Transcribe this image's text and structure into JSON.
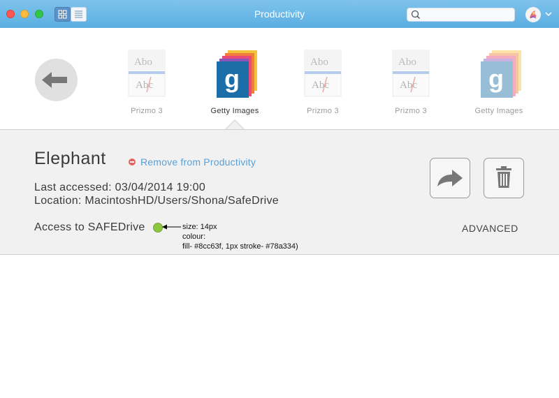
{
  "window": {
    "title": "Productivity"
  },
  "search": {
    "placeholder": ""
  },
  "apps": [
    {
      "label": "Prizmo 3",
      "icon": "prizmo-icon",
      "selected": false
    },
    {
      "label": "Getty Images",
      "icon": "getty-icon",
      "selected": true
    },
    {
      "label": "Prizmo 3",
      "icon": "prizmo-icon",
      "selected": false
    },
    {
      "label": "Prizmo 3",
      "icon": "prizmo-icon",
      "selected": false
    },
    {
      "label": "Getty Images",
      "icon": "getty-icon",
      "selected": false
    }
  ],
  "detail": {
    "name": "Elephant",
    "remove_label": "Remove from Productivity",
    "last_accessed": "Last accessed: 03/04/2014 19:00",
    "location": "Location: MacintoshHD/Users/Shona/SafeDrive",
    "access_label": "Access to SAFEDrive",
    "advanced_label": "ADVANCED",
    "status_dot": {
      "fill": "#8cc63f",
      "stroke": "#78a334"
    }
  },
  "annotation": {
    "line1": "size: 14px",
    "line2": "colour:",
    "line3": "fill- #8cc63f,  1px stroke- #78a334)"
  },
  "colors": {
    "titlebar": "#5aaee2",
    "link": "#5aa0d6",
    "remove_icon": "#e16262"
  }
}
